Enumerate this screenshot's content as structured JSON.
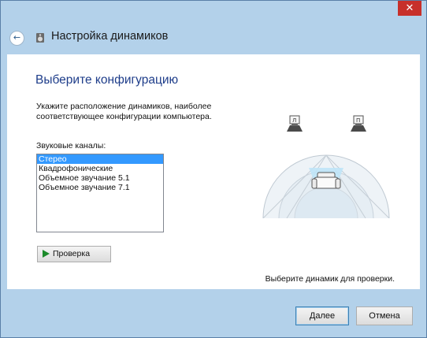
{
  "window": {
    "close_glyph": "✕"
  },
  "header": {
    "title": "Настройка динамиков",
    "back_glyph": "←"
  },
  "page": {
    "title": "Выберите конфигурацию",
    "description": "Укажите расположение динамиков, наиболее соответствующее конфигурации компьютера.",
    "channels_label": "Звуковые каналы:",
    "channels": [
      {
        "label": "Стерео",
        "selected": true
      },
      {
        "label": "Квадрофонические",
        "selected": false
      },
      {
        "label": "Объемное звучание 5.1",
        "selected": false
      },
      {
        "label": "Объемное звучание 7.1",
        "selected": false
      }
    ],
    "test_button": "Проверка",
    "speaker_hint": "Выберите динамик для проверки."
  },
  "buttons": {
    "next": "Далее",
    "cancel": "Отмена"
  },
  "colors": {
    "title_blue": "#1e3d8a",
    "selection": "#3399ff",
    "close_red": "#c7302b",
    "chrome": "#b3d1ea"
  }
}
